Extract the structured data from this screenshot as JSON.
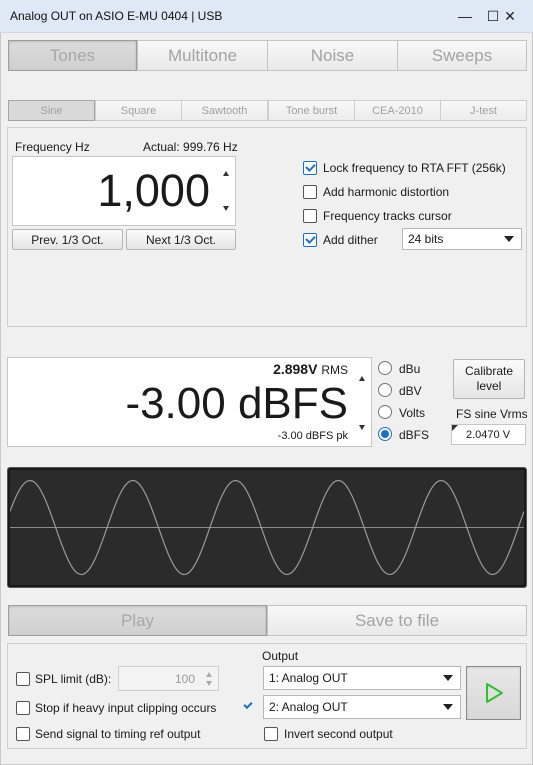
{
  "window": {
    "title": "Analog OUT on ASIO E-MU 0404 | USB",
    "minimize": "—",
    "maximize": "☐",
    "close": "✕"
  },
  "main_tabs": [
    "Tones",
    "Multitone",
    "Noise",
    "Sweeps"
  ],
  "sub_tabs": [
    "Sine",
    "Square",
    "Sawtooth",
    "Tone burst",
    "CEA-2010",
    "J-test"
  ],
  "frequency": {
    "label": "Frequency Hz",
    "actual": "Actual: 999.76 Hz",
    "value": "1,000",
    "prev_button": "Prev. 1/3 Oct.",
    "next_button": "Next 1/3 Oct."
  },
  "options": {
    "lock_rta": {
      "label": "Lock frequency to RTA FFT (256k)",
      "checked": true
    },
    "harmonic": {
      "label": "Add harmonic distortion",
      "checked": false
    },
    "tracks_cursor": {
      "label": "Frequency tracks cursor",
      "checked": false
    },
    "dither": {
      "label": "Add dither",
      "checked": true
    },
    "dither_bits": "24 bits"
  },
  "level": {
    "rms_value": "2.898V",
    "rms_unit": "RMS",
    "value": "-3.00 dBFS",
    "peak": "-3.00 dBFS pk",
    "units": [
      "dBu",
      "dBV",
      "Volts",
      "dBFS"
    ],
    "selected_unit": "dBFS",
    "calibrate_line1": "Calibrate",
    "calibrate_line2": "level",
    "fs_label": "FS sine Vrms",
    "fs_value": "2.0470 V"
  },
  "waveform": {
    "cycles": 5,
    "background": "#2b2b2b",
    "line_color": "#9a9a9a"
  },
  "actions": {
    "play": "Play",
    "save": "Save to file"
  },
  "bottom": {
    "spl_label": "SPL limit (dB):",
    "spl_value": "100",
    "stop_clipping": "Stop if heavy input clipping occurs",
    "timing_ref": "Send signal to timing ref output",
    "output_label": "Output",
    "output1": "1: Analog OUT",
    "output2": "2: Analog OUT",
    "output2_enabled": true,
    "invert_second": "Invert second output"
  },
  "colors": {
    "accent": "#1f6fbf",
    "play_green": "#2fbf2f"
  }
}
